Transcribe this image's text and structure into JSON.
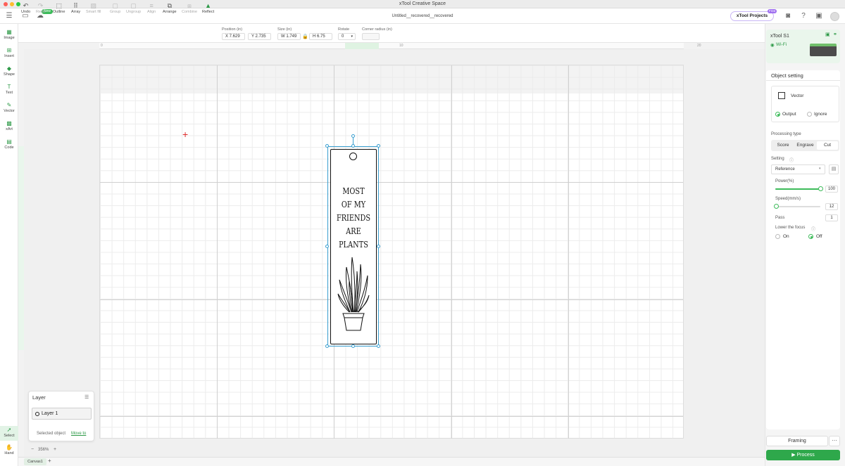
{
  "window": {
    "title": "xTool Creative Space"
  },
  "header": {
    "doc_title": "Untitled__recovered__recovered",
    "new_badge": "New",
    "projects_label": "xTool Projects",
    "projects_badge": "Free"
  },
  "sidebar": {
    "items": [
      {
        "label": "Image",
        "icon": "image-icon"
      },
      {
        "label": "Insert",
        "icon": "insert-icon"
      },
      {
        "label": "Shape",
        "icon": "shape-icon"
      },
      {
        "label": "Text",
        "icon": "text-icon"
      },
      {
        "label": "Vector",
        "icon": "vector-icon"
      },
      {
        "label": "xArt",
        "icon": "xart-icon"
      },
      {
        "label": "Code",
        "icon": "code-icon"
      }
    ],
    "bottom_items": [
      {
        "label": "Select",
        "icon": "select-icon"
      },
      {
        "label": "Hand",
        "icon": "hand-icon"
      }
    ]
  },
  "toolbar": {
    "undo": "Undo",
    "redo": "Redo",
    "outline": "Outline",
    "array": "Array",
    "smart_fill": "Smart fill",
    "group": "Group",
    "ungroup": "Ungroup",
    "align": "Align",
    "arrange": "Arrange",
    "combine": "Combine",
    "reflect": "Reflect",
    "position_label": "Position (in)",
    "pos_x": "X 7.629",
    "pos_y": "Y 2.735",
    "size_label": "Size (in)",
    "size_w": "W 1.749",
    "size_h": "H 6.75",
    "rotate_label": "Rotate",
    "rotate_value": "0",
    "corner_label": "Corner radius (in)",
    "corner_value": ""
  },
  "ruler": {
    "marks": [
      "0",
      "10",
      "20"
    ]
  },
  "artwork": {
    "lines": [
      "MOST",
      "OF MY",
      "FRIENDS",
      "ARE",
      "PLANTS"
    ]
  },
  "layer_panel": {
    "title": "Layer",
    "layer_name": "Layer 1",
    "selected_text": "Selected object",
    "move_link": "Move to"
  },
  "zoom": {
    "minus": "−",
    "value": "356%",
    "plus": "+"
  },
  "tabs": {
    "canvas": "Canvas1",
    "add": "+"
  },
  "device": {
    "name": "xTool S1",
    "connection": "Wi-Fi"
  },
  "object_setting": {
    "title": "Object setting",
    "type": "Vector",
    "output": "Output",
    "ignore": "Ignore",
    "processing_label": "Processing type",
    "proc_score": "Score",
    "proc_engrave": "Engrave",
    "proc_cut": "Cut",
    "proc_selected": "Cut",
    "setting_label": "Setting",
    "setting_value": "Reference",
    "power_label": "Power(%)",
    "power_value": "100",
    "power_fraction": 1.0,
    "speed_label": "Speed(mm/s)",
    "speed_value": "12",
    "speed_fraction": 0.02,
    "pass_label": "Pass",
    "pass_value": "1",
    "focus_label": "Lower the focus",
    "focus_on": "On",
    "focus_off": "Off",
    "focus_selected": "Off"
  },
  "actions": {
    "framing": "Framing",
    "more": "⋯",
    "process": "Process"
  },
  "colors": {
    "accent": "#2ea84b",
    "selection": "#3a9fd0",
    "crosshair": "#e03030"
  }
}
